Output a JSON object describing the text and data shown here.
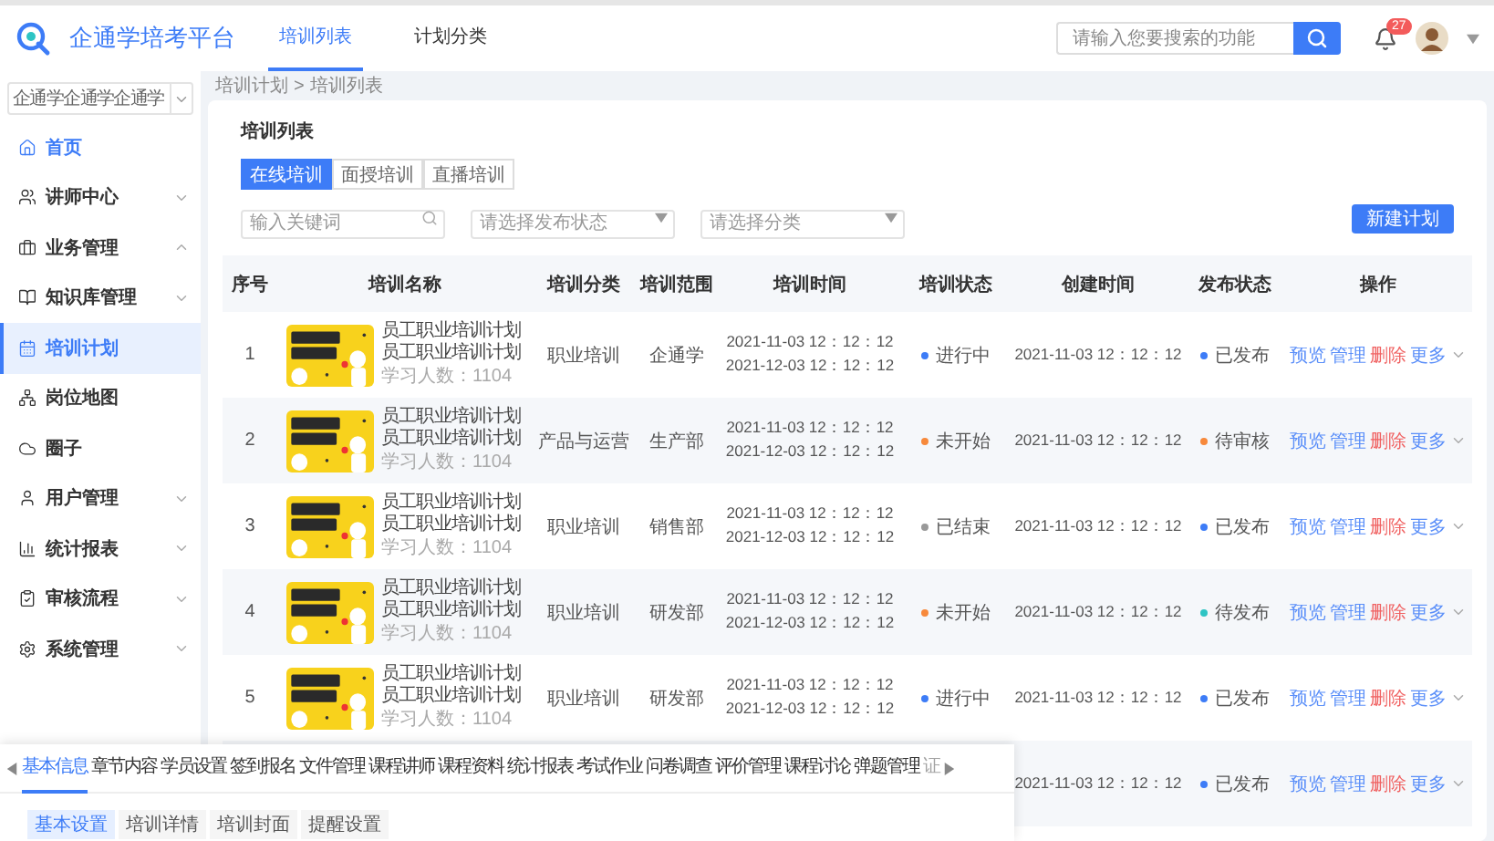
{
  "header": {
    "brand": "企通学培考平台",
    "tabs": [
      {
        "label": "培训列表",
        "selected": true
      },
      {
        "label": "计划分类",
        "selected": false
      }
    ],
    "search": {
      "placeholder": "请输入您要搜索的功能"
    },
    "notification_count": "27"
  },
  "sidebar": {
    "org_select": "企通学企通学企通学",
    "items": [
      {
        "label": "首页",
        "kind": "link",
        "selected": false,
        "active": true
      },
      {
        "label": "讲师中心",
        "kind": "group",
        "selected": false,
        "active": false,
        "expanded": false
      },
      {
        "label": "业务管理",
        "kind": "group",
        "selected": false,
        "active": false,
        "expanded": true
      },
      {
        "label": "知识库管理",
        "kind": "group",
        "selected": false,
        "active": false,
        "expanded": false
      },
      {
        "label": "培训计划",
        "kind": "link",
        "selected": true,
        "active": false
      },
      {
        "label": "岗位地图",
        "kind": "link",
        "selected": false,
        "active": false
      },
      {
        "label": "圈子",
        "kind": "link",
        "selected": false,
        "active": false
      },
      {
        "label": "用户管理",
        "kind": "group",
        "selected": false,
        "active": false,
        "expanded": false
      },
      {
        "label": "统计报表",
        "kind": "group",
        "selected": false,
        "active": false,
        "expanded": false
      },
      {
        "label": "审核流程",
        "kind": "group",
        "selected": false,
        "active": false,
        "expanded": false
      },
      {
        "label": "系统管理",
        "kind": "group",
        "selected": false,
        "active": false,
        "expanded": false
      }
    ]
  },
  "breadcrumb": {
    "items": [
      "培训计划",
      "培训列表"
    ],
    "separator": ">"
  },
  "card": {
    "title": "培训列表",
    "segments": [
      {
        "label": "在线培训",
        "selected": true
      },
      {
        "label": "面授培训",
        "selected": false
      },
      {
        "label": "直播培训",
        "selected": false
      }
    ],
    "filters": {
      "keyword": {
        "placeholder": "输入关键词"
      },
      "publish_status": {
        "placeholder": "请选择发布状态"
      },
      "category": {
        "placeholder": "请选择分类"
      }
    },
    "new_button": "新建计划",
    "table": {
      "columns": [
        "序号",
        "培训名称",
        "培训分类",
        "培训范围",
        "培训时间",
        "培训状态",
        "创建时间",
        "发布状态",
        "操作"
      ],
      "rows": [
        {
          "index": "1",
          "name": "员工职业培训计划员工职业培训计划",
          "learners": "学习人数：1104",
          "category": "职业培训",
          "scope": "企通学",
          "time_start": "2021-11-03 12：12：12",
          "time_end": "2021-12-03 12：12：12",
          "training_status": {
            "text": "进行中",
            "color": "#3d7cf7"
          },
          "created": "2021-11-03 12：12：12",
          "publish_status": {
            "text": "已发布",
            "color": "#3d7cf7"
          },
          "actions": [
            {
              "label": "预览",
              "kind": "link"
            },
            {
              "label": "管理",
              "kind": "link"
            },
            {
              "label": "删除",
              "kind": "danger"
            },
            {
              "label": "更多",
              "kind": "menu"
            }
          ]
        },
        {
          "index": "2",
          "name": "员工职业培训计划员工职业培训计划",
          "learners": "学习人数：1104",
          "category": "产品与运营",
          "scope": "生产部",
          "time_start": "2021-11-03 12：12：12",
          "time_end": "2021-12-03 12：12：12",
          "training_status": {
            "text": "未开始",
            "color": "#f7893b"
          },
          "created": "2021-11-03 12：12：12",
          "publish_status": {
            "text": "待审核",
            "color": "#f7893b"
          },
          "actions": [
            {
              "label": "预览",
              "kind": "link"
            },
            {
              "label": "管理",
              "kind": "link"
            },
            {
              "label": "删除",
              "kind": "danger"
            },
            {
              "label": "更多",
              "kind": "menu"
            }
          ]
        },
        {
          "index": "3",
          "name": "员工职业培训计划员工职业培训计划",
          "learners": "学习人数：1104",
          "category": "职业培训",
          "scope": "销售部",
          "time_start": "2021-11-03 12：12：12",
          "time_end": "2021-12-03 12：12：12",
          "training_status": {
            "text": "已结束",
            "color": "#999999"
          },
          "created": "2021-11-03 12：12：12",
          "publish_status": {
            "text": "已发布",
            "color": "#3d7cf7"
          },
          "actions": [
            {
              "label": "预览",
              "kind": "link"
            },
            {
              "label": "管理",
              "kind": "link"
            },
            {
              "label": "删除",
              "kind": "danger"
            },
            {
              "label": "更多",
              "kind": "menu"
            }
          ]
        },
        {
          "index": "4",
          "name": "员工职业培训计划员工职业培训计划",
          "learners": "学习人数：1104",
          "category": "职业培训",
          "scope": "研发部",
          "time_start": "2021-11-03 12：12：12",
          "time_end": "2021-12-03 12：12：12",
          "training_status": {
            "text": "未开始",
            "color": "#f7893b"
          },
          "created": "2021-11-03 12：12：12",
          "publish_status": {
            "text": "待发布",
            "color": "#2ec4c4"
          },
          "actions": [
            {
              "label": "预览",
              "kind": "link"
            },
            {
              "label": "管理",
              "kind": "link"
            },
            {
              "label": "删除",
              "kind": "danger"
            },
            {
              "label": "更多",
              "kind": "menu"
            }
          ]
        },
        {
          "index": "5",
          "name": "员工职业培训计划员工职业培训计划",
          "learners": "学习人数：1104",
          "category": "职业培训",
          "scope": "研发部",
          "time_start": "2021-11-03 12：12：12",
          "time_end": "2021-12-03 12：12：12",
          "training_status": {
            "text": "进行中",
            "color": "#3d7cf7"
          },
          "created": "2021-11-03 12：12：12",
          "publish_status": {
            "text": "已发布",
            "color": "#3d7cf7"
          },
          "actions": [
            {
              "label": "预览",
              "kind": "link"
            },
            {
              "label": "管理",
              "kind": "link"
            },
            {
              "label": "删除",
              "kind": "danger"
            },
            {
              "label": "更多",
              "kind": "menu"
            }
          ]
        },
        {
          "created": "2021-11-03 12：12：12",
          "publish_status": {
            "text": "已发布",
            "color": "#3d7cf7"
          },
          "actions": [
            {
              "label": "预览",
              "kind": "link"
            },
            {
              "label": "管理",
              "kind": "link"
            },
            {
              "label": "删除",
              "kind": "danger"
            },
            {
              "label": "更多",
              "kind": "menu"
            }
          ]
        }
      ]
    }
  },
  "settings_panel": {
    "tabs": [
      {
        "label": "基本信息",
        "selected": true
      },
      {
        "label": "章节内容",
        "selected": false
      },
      {
        "label": "学员设置",
        "selected": false
      },
      {
        "label": "签到报名",
        "selected": false
      },
      {
        "label": "文件管理",
        "selected": false
      },
      {
        "label": "课程讲师",
        "selected": false
      },
      {
        "label": "课程资料",
        "selected": false
      },
      {
        "label": "统计报表",
        "selected": false
      },
      {
        "label": "考试作业",
        "selected": false
      },
      {
        "label": "问卷调查",
        "selected": false
      },
      {
        "label": "评价管理",
        "selected": false
      },
      {
        "label": "课程讨论",
        "selected": false
      },
      {
        "label": "弹题管理",
        "selected": false
      },
      {
        "label": "证",
        "selected": false
      }
    ],
    "subtabs": [
      {
        "label": "基本设置",
        "selected": true
      },
      {
        "label": "培训详情",
        "selected": false
      },
      {
        "label": "培训封面",
        "selected": false
      },
      {
        "label": "提醒设置",
        "selected": false
      }
    ]
  }
}
